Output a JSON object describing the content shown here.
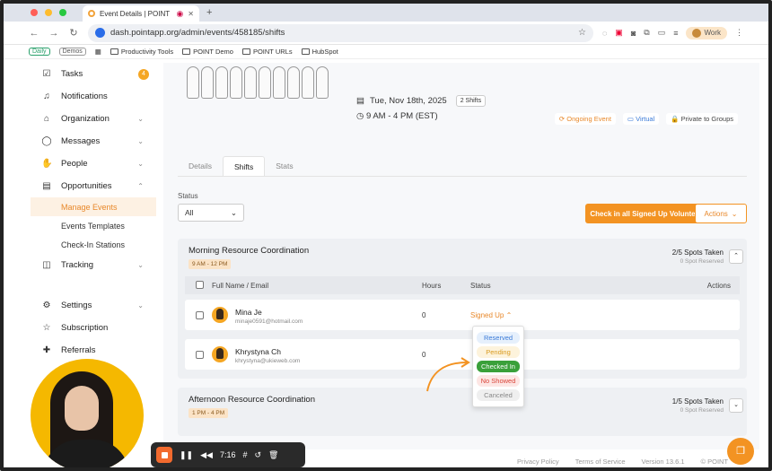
{
  "browser": {
    "tab_title": "Event Details | POINT",
    "url": "dash.pointapp.org/admin/events/458185/shifts",
    "profile": "Work",
    "bookmarks": [
      "Daily",
      "Demos",
      "Productivity Tools",
      "POINT Demo",
      "POINT URLs",
      "HubSpot"
    ]
  },
  "sidebar": {
    "tasks": "Tasks",
    "tasks_badge": "4",
    "notifications": "Notifications",
    "organization": "Organization",
    "messages": "Messages",
    "people": "People",
    "opportunities": "Opportunities",
    "manage_events": "Manage Events",
    "events_templates": "Events Templates",
    "checkin_stations": "Check-In Stations",
    "tracking": "Tracking",
    "settings": "Settings",
    "subscription": "Subscription",
    "referrals": "Referrals"
  },
  "event": {
    "date": "Tue, Nov 18th, 2025",
    "shifts_count": "2 Shifts",
    "time": "9 AM - 4 PM (EST)",
    "chips": [
      "Ongoing Event",
      "Virtual",
      "Private to Groups"
    ]
  },
  "tabs": [
    "Details",
    "Shifts",
    "Stats"
  ],
  "filters": {
    "status_label": "Status",
    "status_value": "All",
    "checkin_all": "Check in all Signed Up Volunteers",
    "actions": "Actions"
  },
  "shifts": [
    {
      "title": "Morning Resource Coordination",
      "time": "9 AM - 12 PM",
      "spots": "2/5 Spots Taken",
      "reserved": "0 Spot Reserved",
      "headers": {
        "name": "Full Name / Email",
        "hours": "Hours",
        "status": "Status",
        "actions": "Actions"
      },
      "volunteers": [
        {
          "name": "Mina Je",
          "email": "minaje0591@hotmail.com",
          "hours": "0",
          "status": "Signed Up"
        },
        {
          "name": "Khrystyna Ch",
          "email": "khrystyna@ukieweb.com",
          "hours": "0",
          "status": ""
        }
      ]
    },
    {
      "title": "Afternoon Resource Coordination",
      "time": "1 PM - 4 PM",
      "spots": "1/5 Spots Taken",
      "reserved": "0 Spot Reserved"
    }
  ],
  "status_options": [
    {
      "label": "Reserved",
      "color": "#3b7bd8",
      "bg": "#e6f0fc"
    },
    {
      "label": "Pending",
      "color": "#d99a1e",
      "bg": "#fdf3dc"
    },
    {
      "label": "Checked In",
      "color": "#ffffff",
      "bg": "#3aa03a"
    },
    {
      "label": "No Showed",
      "color": "#d9453a",
      "bg": "#fde6e4"
    },
    {
      "label": "Canceled",
      "color": "#888888",
      "bg": "#efefef"
    }
  ],
  "footer": {
    "privacy": "Privacy Policy",
    "terms": "Terms of Service",
    "version": "Version 13.6.1",
    "brand": "© POINT"
  },
  "recorder": {
    "time": "7:16"
  }
}
